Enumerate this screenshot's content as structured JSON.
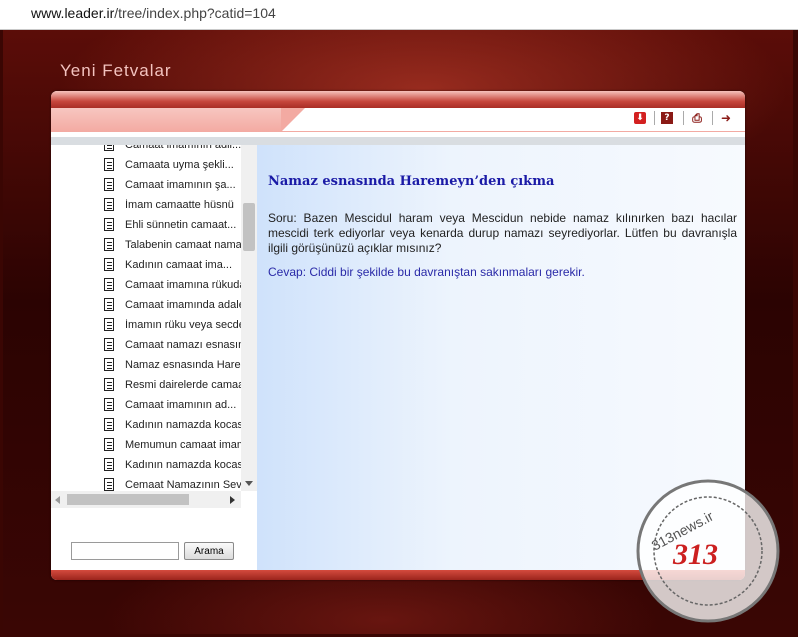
{
  "browser": {
    "url_domain": "www.leader.ir",
    "url_path": "/tree/index.php?catid=104"
  },
  "page": {
    "title": "Yeni Fetvalar"
  },
  "toolbar": {
    "icons": [
      "download-icon",
      "help-icon",
      "print-icon",
      "arrow-icon"
    ],
    "help_glyph": "?"
  },
  "tree": {
    "items": [
      "Camaat imamının adil...",
      "Camaata uyma şekli...",
      "Camaat imamının şa...",
      "İmam camaatte hüsnü",
      "Ehli sünnetin camaat...",
      "Talabenin camaat namaz",
      "Kadının camaat ima...",
      "Camaat imamına rükuda",
      "Camaat imamında adalet",
      "İmamın rüku veya secde",
      "Camaat namazı esnasında",
      "Namaz esnasında Harem",
      "Resmi dairelerde camaat",
      "Camaat imamının ad...",
      "Kadının namazda kocasın",
      "Memumun camaat imamı",
      "Kadının namazda kocasın",
      "Cemaat Namazının Sevab"
    ]
  },
  "search": {
    "value": "",
    "button_label": "Arama"
  },
  "article": {
    "title": "Namaz esnasında Haremeyn’den çıkma",
    "question": "Soru: Bazen Mescidul haram veya Mescidun nebide namaz kılınırken bazı hacılar mescidi terk ediyorlar veya kenarda durup namazı seyrediyorlar. Lütfen bu davranışla ilgili görüşünüzü açıklar mısınız?",
    "answer": "Cevap: Ciddi bir şekilde bu davranıştan sakınmaları gerekir."
  },
  "watermark": {
    "text": "313news.ir",
    "number": "313",
    "color": "#cc2020"
  }
}
